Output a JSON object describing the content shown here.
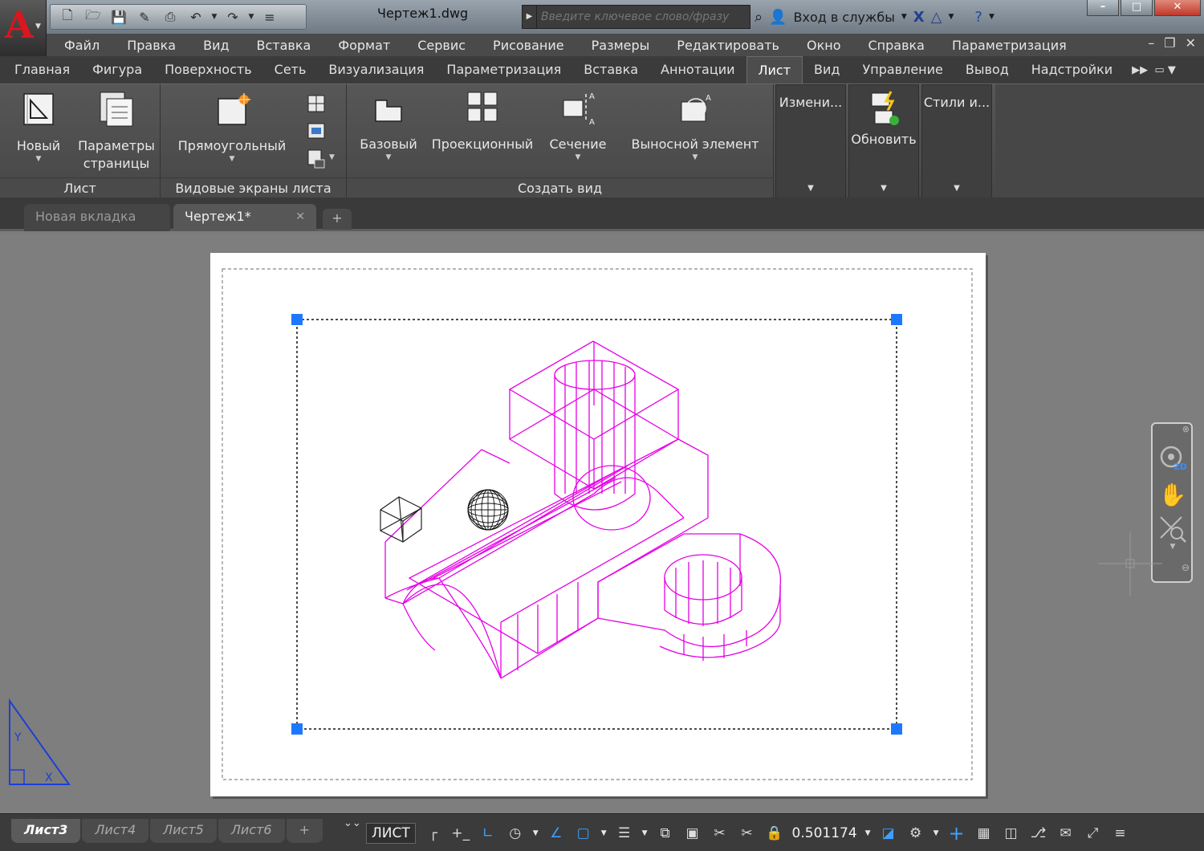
{
  "title_bar": {
    "file_title": "Чертеж1.dwg",
    "search_placeholder": "Введите ключевое слово/фразу",
    "login_label": "Вход в службы"
  },
  "menu": [
    "Файл",
    "Правка",
    "Вид",
    "Вставка",
    "Формат",
    "Сервис",
    "Рисование",
    "Размеры",
    "Редактировать",
    "Окно",
    "Справка",
    "Параметризация"
  ],
  "ribbon_tabs": [
    "Главная",
    "Фигура",
    "Поверхность",
    "Сеть",
    "Визуализация",
    "Параметризация",
    "Вставка",
    "Аннотации",
    "Лист",
    "Вид",
    "Управление",
    "Вывод",
    "Надстройки"
  ],
  "ribbon": {
    "panel_sheet": {
      "title": "Лист",
      "new_label": "Новый",
      "page_setup_label": "Параметры\nстраницы"
    },
    "panel_viewports": {
      "title": "Видовые экраны листа",
      "rect_label": "Прямоугольный"
    },
    "panel_create_view": {
      "title": "Создать вид",
      "base_label": "Базовый",
      "projected_label": "Проекционный",
      "section_label": "Сечение",
      "detail_label": "Выносной элемент"
    },
    "panel_modify": {
      "label": "Измени..."
    },
    "panel_update": {
      "label": "Обновить"
    },
    "panel_styles": {
      "label": "Стили и..."
    }
  },
  "doc_tabs": {
    "new_tab": "Новая вкладка",
    "drawing_tab": "Чертеж1*"
  },
  "layout_tabs": [
    "Лист3",
    "Лист4",
    "Лист5",
    "Лист6"
  ],
  "status": {
    "mode": "ЛИСТ",
    "scale": "0.501174"
  },
  "colors": {
    "model_lines": "#e600e6",
    "grip": "#1e78ff",
    "accent_blue": "#3ea0ff",
    "logo_red": "#d8171e"
  }
}
